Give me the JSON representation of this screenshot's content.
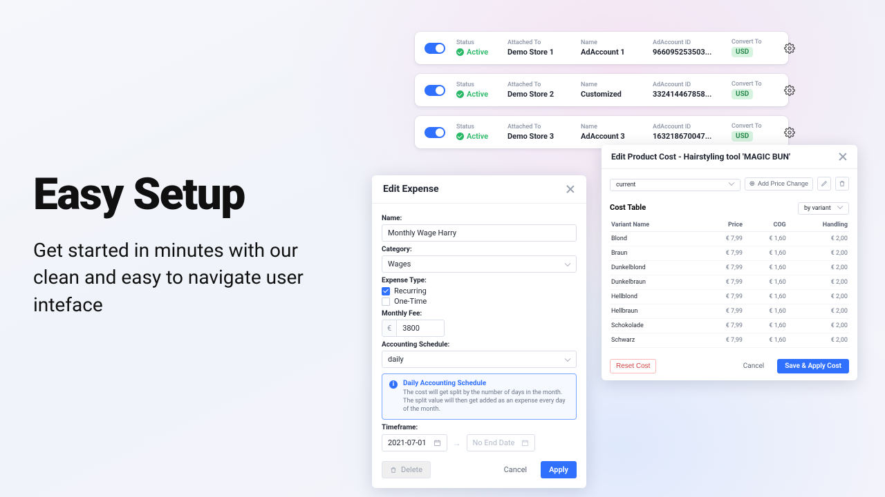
{
  "hero": {
    "title": "Easy Setup",
    "subtitle": "Get started in minutes with our clean and easy to navigate user inteface"
  },
  "labels": {
    "status": "Status",
    "attached": "Attached To",
    "name": "Name",
    "acctId": "AdAccount ID",
    "convert": "Convert To",
    "active": "Active"
  },
  "accounts": [
    {
      "attached": "Demo Store 1",
      "name": "AdAccount 1",
      "id": "966095253503...",
      "ccy": "USD"
    },
    {
      "attached": "Demo Store 2",
      "name": "Customized",
      "id": "332414467858...",
      "ccy": "USD"
    },
    {
      "attached": "Demo Store 3",
      "name": "AdAccount 3",
      "id": "163218670047...",
      "ccy": "USD"
    }
  ],
  "expense": {
    "title": "Edit Expense",
    "nameLabel": "Name:",
    "nameVal": "Monthly Wage Harry",
    "catLabel": "Category:",
    "catVal": "Wages",
    "typeLabel": "Expense Type:",
    "recurring": "Recurring",
    "oneTime": "One-Time",
    "feeLabel": "Monthly Fee:",
    "feeCcy": "€",
    "feeVal": "3800",
    "schedLabel": "Accounting Schedule:",
    "schedVal": "daily",
    "infoTitle": "Daily Accounting Schedule",
    "infoDesc": "The cost will get split by the number of days in the month. The split value will then get added as an expense every day of the month.",
    "tfLabel": "Timeframe:",
    "tfStart": "2021-07-01",
    "tfEndPh": "No End Date",
    "delete": "Delete",
    "cancel": "Cancel",
    "apply": "Apply"
  },
  "cost": {
    "title": "Edit Product Cost - Hairstyling tool 'MAGIC BUN'",
    "range": "current",
    "addChange": "Add Price Change",
    "tableTitle": "Cost Table",
    "viewBy": "by variant",
    "headers": {
      "variant": "Variant Name",
      "price": "Price",
      "cog": "COG",
      "handling": "Handling"
    },
    "rows": [
      {
        "n": "Blond",
        "p": "€ 7,99",
        "c": "€ 1,60",
        "h": "€ 2,00"
      },
      {
        "n": "Braun",
        "p": "€ 7,99",
        "c": "€ 1,60",
        "h": "€ 2,00"
      },
      {
        "n": "Dunkelblond",
        "p": "€ 7,99",
        "c": "€ 1,60",
        "h": "€ 2,00"
      },
      {
        "n": "Dunkelbraun",
        "p": "€ 7,99",
        "c": "€ 1,60",
        "h": "€ 2,00"
      },
      {
        "n": "Hellblond",
        "p": "€ 7,99",
        "c": "€ 1,60",
        "h": "€ 2,00"
      },
      {
        "n": "Hellbraun",
        "p": "€ 7,99",
        "c": "€ 1,60",
        "h": "€ 2,00"
      },
      {
        "n": "Schokolade",
        "p": "€ 7,99",
        "c": "€ 1,60",
        "h": "€ 2,00"
      },
      {
        "n": "Schwarz",
        "p": "€ 7,99",
        "c": "€ 1,60",
        "h": "€ 2,00"
      }
    ],
    "reset": "Reset Cost",
    "cancel": "Cancel",
    "save": "Save & Apply Cost"
  }
}
